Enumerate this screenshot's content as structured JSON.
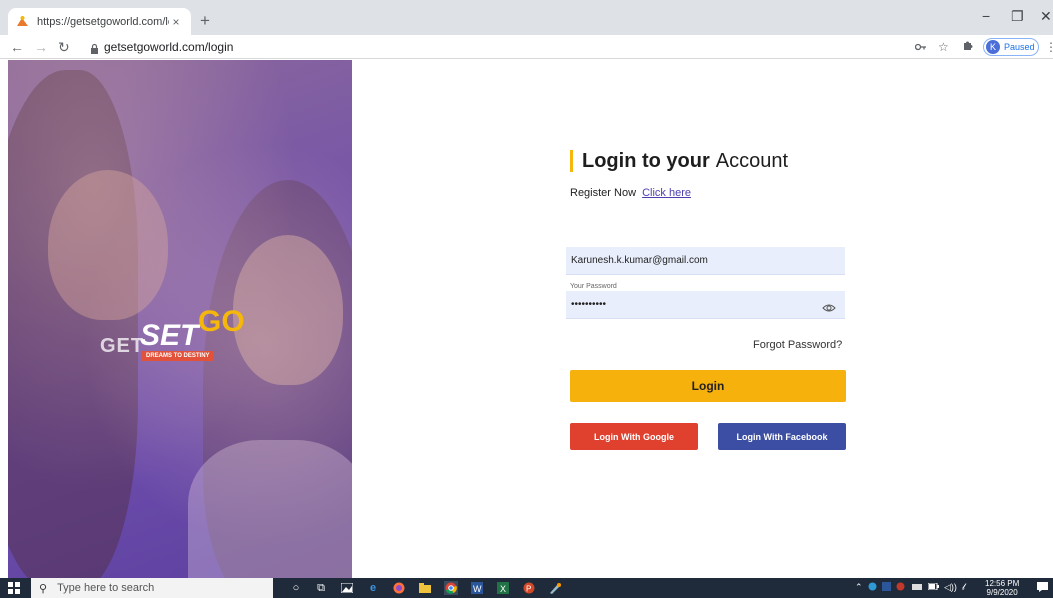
{
  "browser": {
    "tab_title": "https://getsetgoworld.com/login",
    "tab_close": "×",
    "new_tab": "+",
    "url": "getsetgoworld.com/login",
    "profile_initial": "K",
    "profile_status": "Paused",
    "window_min": "−",
    "window_max": "❐",
    "window_close": "✕"
  },
  "hero": {
    "logo_get": "GET",
    "logo_set": "SET",
    "logo_go": "GO",
    "logo_tagline": "DREAMS TO DESTINY"
  },
  "form": {
    "heading_bold": "Login to your",
    "heading_light": "Account",
    "register_text": "Register Now",
    "register_link": "Click here",
    "email_value": "Karunesh.k.kumar@gmail.com",
    "password_label": "Your Password",
    "password_value": "••••••••••",
    "forgot_password": "Forgot Password?",
    "login_button": "Login",
    "google_button": "Login With Google",
    "facebook_button": "Login With Facebook"
  },
  "taskbar": {
    "search_placeholder": "Type here to search",
    "time": "12:56 PM",
    "date": "9/9/2020"
  },
  "colors": {
    "accent_yellow": "#f7b10c",
    "google_red": "#e0412e",
    "facebook_blue": "#3b4ea3",
    "hero_purple": "#6f4fae",
    "link_purple": "#4c3fb0"
  }
}
